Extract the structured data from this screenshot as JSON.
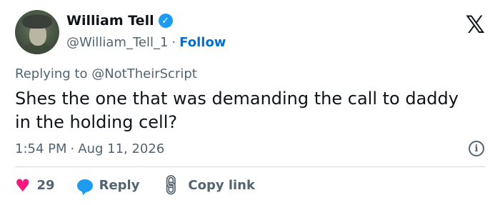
{
  "author": {
    "name": "William Tell",
    "handle": "@William_Tell_1",
    "follow_label": "Follow",
    "separator": "·"
  },
  "tweet": {
    "replying_to": "Replying to @NotTheirScript",
    "text": "Shes the one that was demanding the call to daddy in the holding cell?",
    "time": "1:54 PM",
    "date": "Aug 11, 2026"
  },
  "actions": {
    "like_count": "29",
    "reply_label": "Reply",
    "copy_link_label": "Copy link"
  },
  "icons": {
    "brand": "x-logo-icon",
    "verified": "verified-badge-icon",
    "info": "info-icon",
    "like": "heart-icon",
    "reply": "speech-bubble-icon",
    "copy": "link-icon"
  },
  "colors": {
    "accent_blue": "#1d9bf0",
    "link_blue": "#006fd6",
    "like_pink": "#f91880",
    "text_primary": "#0f1419",
    "text_secondary": "#536471"
  }
}
